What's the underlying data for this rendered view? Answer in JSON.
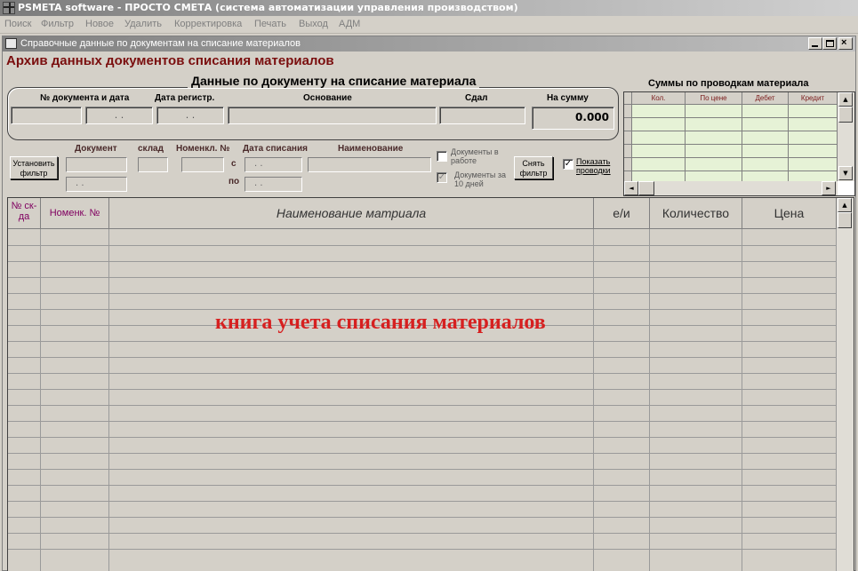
{
  "app": {
    "title": "PSMETA software  -  ПРОСТО СМЕТА (система автоматизации управления производством)"
  },
  "menu": [
    "Поиск",
    "Фильтр",
    "Новое",
    "Удалить",
    "Корректировка",
    "Печать",
    "Выход",
    "АДМ"
  ],
  "window": {
    "title": "Справочные данные по документам на списание материалов"
  },
  "archive_title": "Архив данных документов списания материалов",
  "document_box": {
    "title": "Данные по документу на списание материала",
    "labels": {
      "doc_number_date": "№ документа и дата",
      "reg_date": "Дата регистр.",
      "basis": "Основание",
      "handed": "Сдал",
      "sum": "На сумму"
    },
    "values": {
      "doc_number": "",
      "doc_date": ". .",
      "reg_date": ". .",
      "basis": "",
      "handed": "",
      "sum": "0.000"
    }
  },
  "filter": {
    "set_button": "Установить фильтр",
    "clear_button": "Снять фильтр",
    "labels": {
      "document": "Документ",
      "warehouse": "склад",
      "nomencl": "Номенкл. №",
      "write_off_date": "Дата списания",
      "from": "с",
      "to": "по",
      "name": "Наименование"
    },
    "values": {
      "document": "",
      "document2": ". .",
      "warehouse": "",
      "nomencl": "",
      "date_from": ". .",
      "date_to": ". .",
      "name": ""
    },
    "checks": {
      "in_work_label": "Документы в работе",
      "in_work_checked": false,
      "last10_label": "Документы за 10 дней",
      "last10_checked": true,
      "show_postings_label": "Показать проводки",
      "show_postings_checked": true
    }
  },
  "sums": {
    "title": "Суммы по проводкам  материала",
    "columns": [
      "Кол.",
      "По цене",
      "Дебет",
      "Кредит"
    ],
    "row_count": 6
  },
  "grid": {
    "columns": [
      "№ ск-да",
      "Номенк. №",
      "Наименование матриала",
      "е/и",
      "Количество",
      "Цена"
    ],
    "row_count": 20
  },
  "watermark": "книга учета списания материалов",
  "icons": {
    "checkmark": "✓",
    "scroll_up": "▲",
    "scroll_down": "▼",
    "scroll_left": "◄",
    "scroll_right": "►"
  },
  "colors": {
    "archive_title": "#7a0e0e",
    "watermark": "#d62020",
    "sums_cell": "#e6f2d6",
    "column_header_small": "#800060"
  }
}
